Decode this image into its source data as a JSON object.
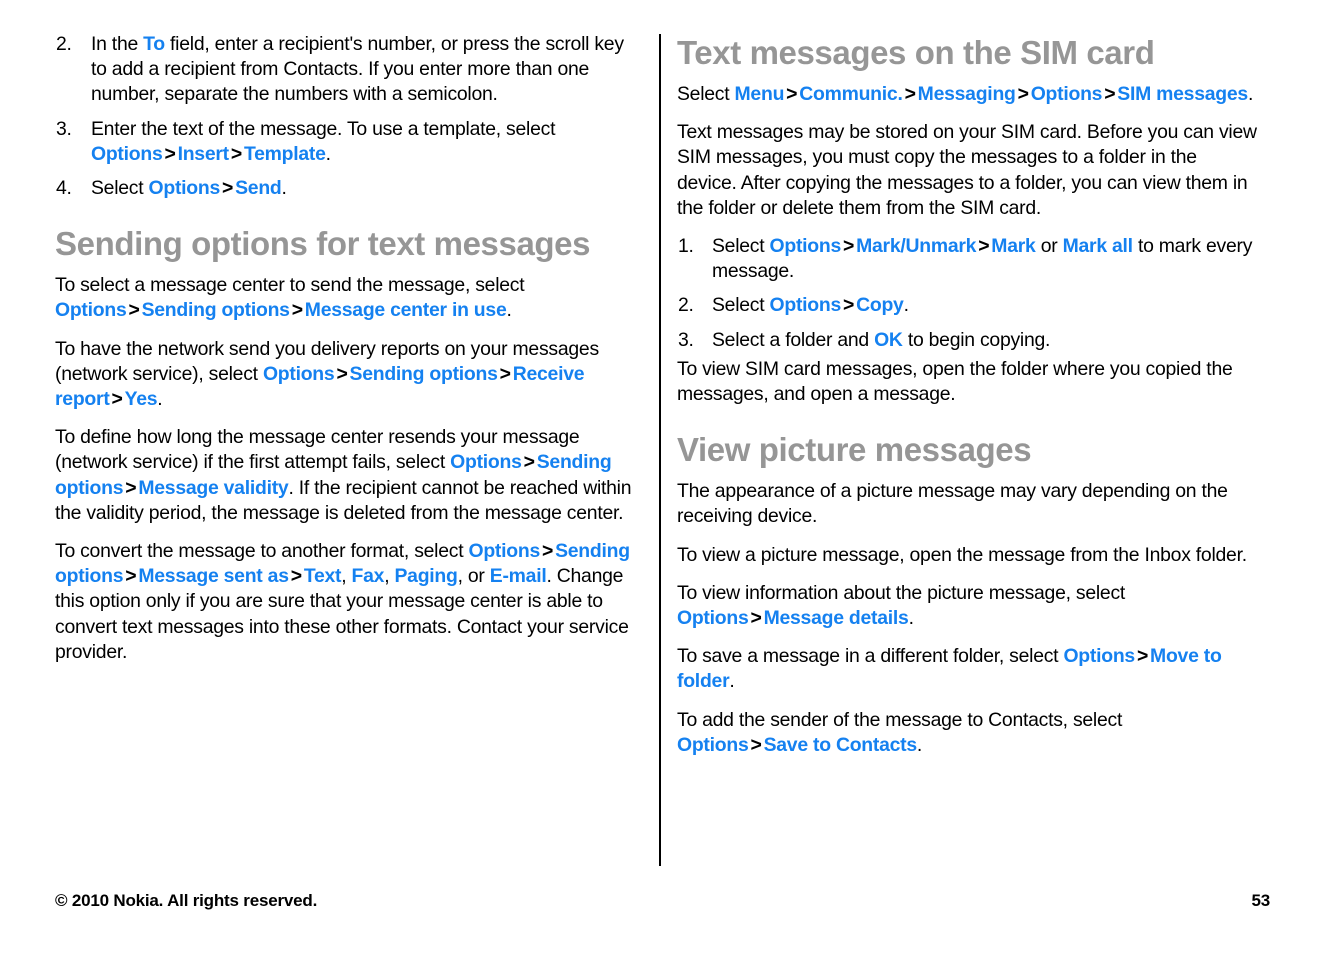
{
  "document": {
    "type": "user-guide-page",
    "page_number": "53",
    "link_color": "#1581f0",
    "heading_color": "#969696",
    "body_color": "#000000",
    "separator": ">"
  },
  "left_column": {
    "steps_continued": [
      {
        "num": "2.",
        "parts": [
          {
            "t": "In the ",
            "k": "plain"
          },
          {
            "t": "To",
            "k": "link"
          },
          {
            "t": " field, enter a recipient's number, or press the scroll key to add a recipient from Contacts. If you enter more than one number, separate the numbers with a semicolon.",
            "k": "plain"
          }
        ]
      },
      {
        "num": "3.",
        "parts": [
          {
            "t": "Enter the text of the message. To use a template, select ",
            "k": "plain"
          },
          {
            "t": "Options",
            "k": "link"
          },
          {
            "t": ">",
            "k": "sep"
          },
          {
            "t": "Insert",
            "k": "link"
          },
          {
            "t": ">",
            "k": "sep"
          },
          {
            "t": "Template",
            "k": "link"
          },
          {
            "t": ".",
            "k": "plain"
          }
        ]
      },
      {
        "num": "4.",
        "parts": [
          {
            "t": "Select ",
            "k": "plain"
          },
          {
            "t": "Options",
            "k": "link"
          },
          {
            "t": ">",
            "k": "sep"
          },
          {
            "t": "Send",
            "k": "link"
          },
          {
            "t": ".",
            "k": "plain"
          }
        ]
      }
    ],
    "section": {
      "title": "Sending options for text messages",
      "paragraphs": [
        [
          {
            "t": "To select a message center to send the message, select ",
            "k": "plain"
          },
          {
            "t": "Options",
            "k": "link"
          },
          {
            "t": ">",
            "k": "sep"
          },
          {
            "t": "Sending options",
            "k": "link"
          },
          {
            "t": ">",
            "k": "sep"
          },
          {
            "t": "Message center in use",
            "k": "link"
          },
          {
            "t": ".",
            "k": "plain"
          }
        ],
        [
          {
            "t": "To have the network send you delivery reports on your messages (network service), select ",
            "k": "plain"
          },
          {
            "t": "Options",
            "k": "link"
          },
          {
            "t": ">",
            "k": "sep"
          },
          {
            "t": "Sending options",
            "k": "link"
          },
          {
            "t": ">",
            "k": "sep"
          },
          {
            "t": "Receive report",
            "k": "link"
          },
          {
            "t": ">",
            "k": "sep"
          },
          {
            "t": "Yes",
            "k": "link"
          },
          {
            "t": ".",
            "k": "plain"
          }
        ],
        [
          {
            "t": "To define how long the message center resends your message (network service) if the first attempt fails, select ",
            "k": "plain"
          },
          {
            "t": "Options",
            "k": "link"
          },
          {
            "t": ">",
            "k": "sep"
          },
          {
            "t": "Sending options",
            "k": "link"
          },
          {
            "t": ">",
            "k": "sep"
          },
          {
            "t": "Message validity",
            "k": "link"
          },
          {
            "t": ". If the recipient cannot be reached within the validity period, the message is deleted from the message center.",
            "k": "plain"
          }
        ],
        [
          {
            "t": "To convert the message to another format, select ",
            "k": "plain"
          },
          {
            "t": "Options",
            "k": "link"
          },
          {
            "t": ">",
            "k": "sep"
          },
          {
            "t": "Sending options",
            "k": "link"
          },
          {
            "t": ">",
            "k": "sep"
          },
          {
            "t": "Message sent as",
            "k": "link"
          },
          {
            "t": ">",
            "k": "sep"
          },
          {
            "t": "Text",
            "k": "link"
          },
          {
            "t": ", ",
            "k": "plain"
          },
          {
            "t": "Fax",
            "k": "link"
          },
          {
            "t": ", ",
            "k": "plain"
          },
          {
            "t": "Paging",
            "k": "link"
          },
          {
            "t": ", or ",
            "k": "plain"
          },
          {
            "t": "E-mail",
            "k": "link"
          },
          {
            "t": ". Change this option only if you are sure that your message center is able to convert text messages into these other formats. Contact your service provider.",
            "k": "plain"
          }
        ]
      ]
    }
  },
  "right_column": {
    "sections": [
      {
        "title": "Text messages on the SIM card",
        "paragraphs_before": [
          [
            {
              "t": "Select ",
              "k": "plain"
            },
            {
              "t": "Menu",
              "k": "link"
            },
            {
              "t": ">",
              "k": "sep"
            },
            {
              "t": "Communic.",
              "k": "link"
            },
            {
              "t": ">",
              "k": "sep"
            },
            {
              "t": "Messaging",
              "k": "link"
            },
            {
              "t": ">",
              "k": "sep"
            },
            {
              "t": "Options",
              "k": "link"
            },
            {
              "t": ">",
              "k": "sep"
            },
            {
              "t": "SIM messages",
              "k": "link"
            },
            {
              "t": ".",
              "k": "plain"
            }
          ],
          [
            {
              "t": "Text messages may be stored on your SIM card. Before you can view SIM messages, you must copy the messages to a folder in the device. After copying the messages to a folder, you can view them in the folder or delete them from the SIM card.",
              "k": "plain"
            }
          ]
        ],
        "steps": [
          {
            "num": "1.",
            "parts": [
              {
                "t": "Select ",
                "k": "plain"
              },
              {
                "t": "Options",
                "k": "link"
              },
              {
                "t": ">",
                "k": "sep"
              },
              {
                "t": "Mark/Unmark",
                "k": "link"
              },
              {
                "t": ">",
                "k": "sep"
              },
              {
                "t": "Mark",
                "k": "link"
              },
              {
                "t": " or ",
                "k": "plain"
              },
              {
                "t": "Mark all",
                "k": "link"
              },
              {
                "t": " to mark every message.",
                "k": "plain"
              }
            ]
          },
          {
            "num": "2.",
            "parts": [
              {
                "t": "Select ",
                "k": "plain"
              },
              {
                "t": "Options",
                "k": "link"
              },
              {
                "t": ">",
                "k": "sep"
              },
              {
                "t": "Copy",
                "k": "link"
              },
              {
                "t": ".",
                "k": "plain"
              }
            ]
          },
          {
            "num": "3.",
            "parts": [
              {
                "t": "Select a folder and ",
                "k": "plain"
              },
              {
                "t": "OK",
                "k": "link"
              },
              {
                "t": " to begin copying.",
                "k": "plain"
              }
            ]
          }
        ],
        "paragraphs_after": [
          [
            {
              "t": "To view SIM card messages, open the folder where you copied the messages, and open a message.",
              "k": "plain"
            }
          ]
        ]
      },
      {
        "title": "View picture messages",
        "paragraphs_before": [
          [
            {
              "t": "The appearance of a picture message may vary depending on the receiving device.",
              "k": "plain"
            }
          ],
          [
            {
              "t": "To view a picture message, open the message from the Inbox folder.",
              "k": "plain"
            }
          ],
          [
            {
              "t": "To view information about the picture message, select ",
              "k": "plain"
            },
            {
              "t": "Options",
              "k": "link"
            },
            {
              "t": ">",
              "k": "sep"
            },
            {
              "t": "Message details",
              "k": "link"
            },
            {
              "t": ".",
              "k": "plain"
            }
          ],
          [
            {
              "t": "To save a message in a different folder, select ",
              "k": "plain"
            },
            {
              "t": "Options",
              "k": "link"
            },
            {
              "t": ">",
              "k": "sep"
            },
            {
              "t": "Move to folder",
              "k": "link"
            },
            {
              "t": ".",
              "k": "plain"
            }
          ],
          [
            {
              "t": "To add the sender of the message to Contacts, select ",
              "k": "plain"
            },
            {
              "t": "Options",
              "k": "link"
            },
            {
              "t": ">",
              "k": "sep"
            },
            {
              "t": "Save to Contacts",
              "k": "link"
            },
            {
              "t": ".",
              "k": "plain"
            }
          ]
        ],
        "steps": [],
        "paragraphs_after": []
      }
    ]
  },
  "footer": {
    "copyright": "© 2010 Nokia. All rights reserved.",
    "page_number": "53"
  }
}
